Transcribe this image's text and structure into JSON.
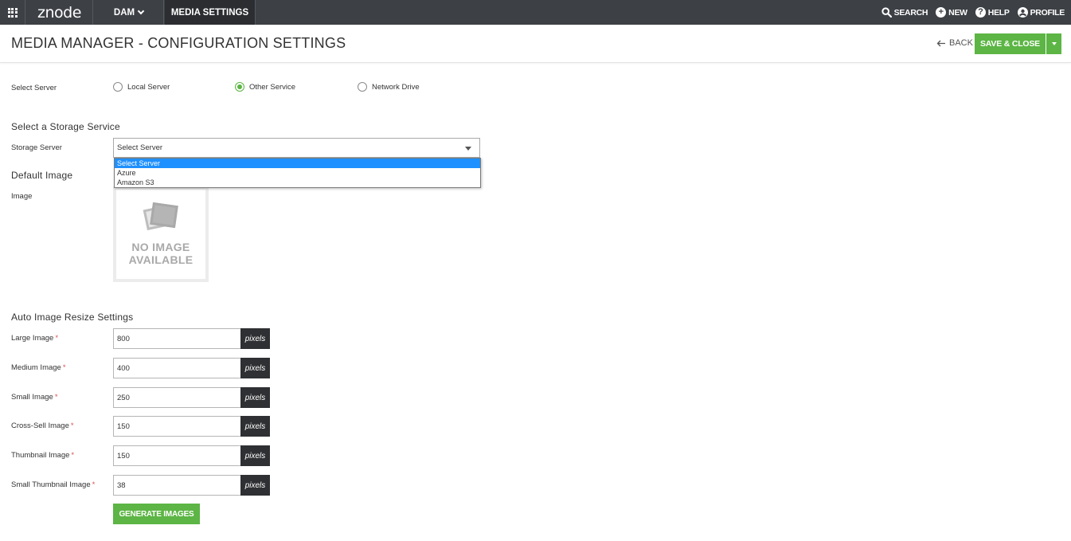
{
  "topbar": {
    "logo": "znode",
    "nav": [
      {
        "label": "DAM"
      },
      {
        "label": "MEDIA SETTINGS"
      }
    ],
    "right": [
      {
        "label": "SEARCH",
        "icon": "search-icon"
      },
      {
        "label": "NEW",
        "icon": "plus-circle-icon"
      },
      {
        "label": "HELP",
        "icon": "help-circle-icon"
      },
      {
        "label": "PROFILE",
        "icon": "user-circle-icon"
      }
    ]
  },
  "header": {
    "title": "MEDIA MANAGER  -  CONFIGURATION SETTINGS",
    "back_label": "BACK",
    "save_label": "SAVE & CLOSE"
  },
  "server": {
    "label": "Select Server",
    "options": [
      {
        "label": "Local Server",
        "selected": false
      },
      {
        "label": "Other Service",
        "selected": true
      },
      {
        "label": "Network Drive",
        "selected": false
      }
    ]
  },
  "storage": {
    "section_title": "Select a Storage Service",
    "label": "Storage Server",
    "value": "Select Server",
    "options": [
      "Select Server",
      "Azure",
      "Amazon S3"
    ],
    "highlighted": "Select Server"
  },
  "default_image": {
    "section_title": "Default Image",
    "label": "Image",
    "placeholder_line1": "NO IMAGE",
    "placeholder_line2": "AVAILABLE"
  },
  "resize": {
    "section_title": "Auto Image Resize Settings",
    "unit": "pixels",
    "rows": [
      {
        "label": "Large Image",
        "value": "800"
      },
      {
        "label": "Medium Image",
        "value": "400"
      },
      {
        "label": "Small Image",
        "value": "250"
      },
      {
        "label": "Cross-Sell Image",
        "value": "150"
      },
      {
        "label": "Thumbnail Image",
        "value": "150"
      },
      {
        "label": "Small Thumbnail Image",
        "value": "38"
      }
    ],
    "required_mark": "*",
    "generate_label": "GENERATE IMAGES"
  },
  "colors": {
    "topbar": "#3d4045",
    "accent_green": "#5cb544",
    "required_red": "#d9534f",
    "dropdown_highlight": "#1e90ff"
  }
}
